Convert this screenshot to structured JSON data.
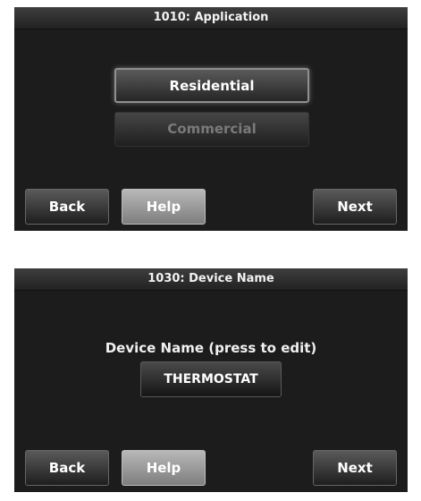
{
  "screen_application": {
    "title": "1010: Application",
    "options": [
      {
        "label": "Residential",
        "selected": true
      },
      {
        "label": "Commercial",
        "selected": false
      }
    ],
    "buttons": {
      "back": "Back",
      "help": "Help",
      "next": "Next"
    }
  },
  "screen_device_name": {
    "title": "1030: Device Name",
    "prompt": "Device Name (press to edit)",
    "device_name_value": "THERMOSTAT",
    "buttons": {
      "back": "Back",
      "help": "Help",
      "next": "Next"
    }
  }
}
